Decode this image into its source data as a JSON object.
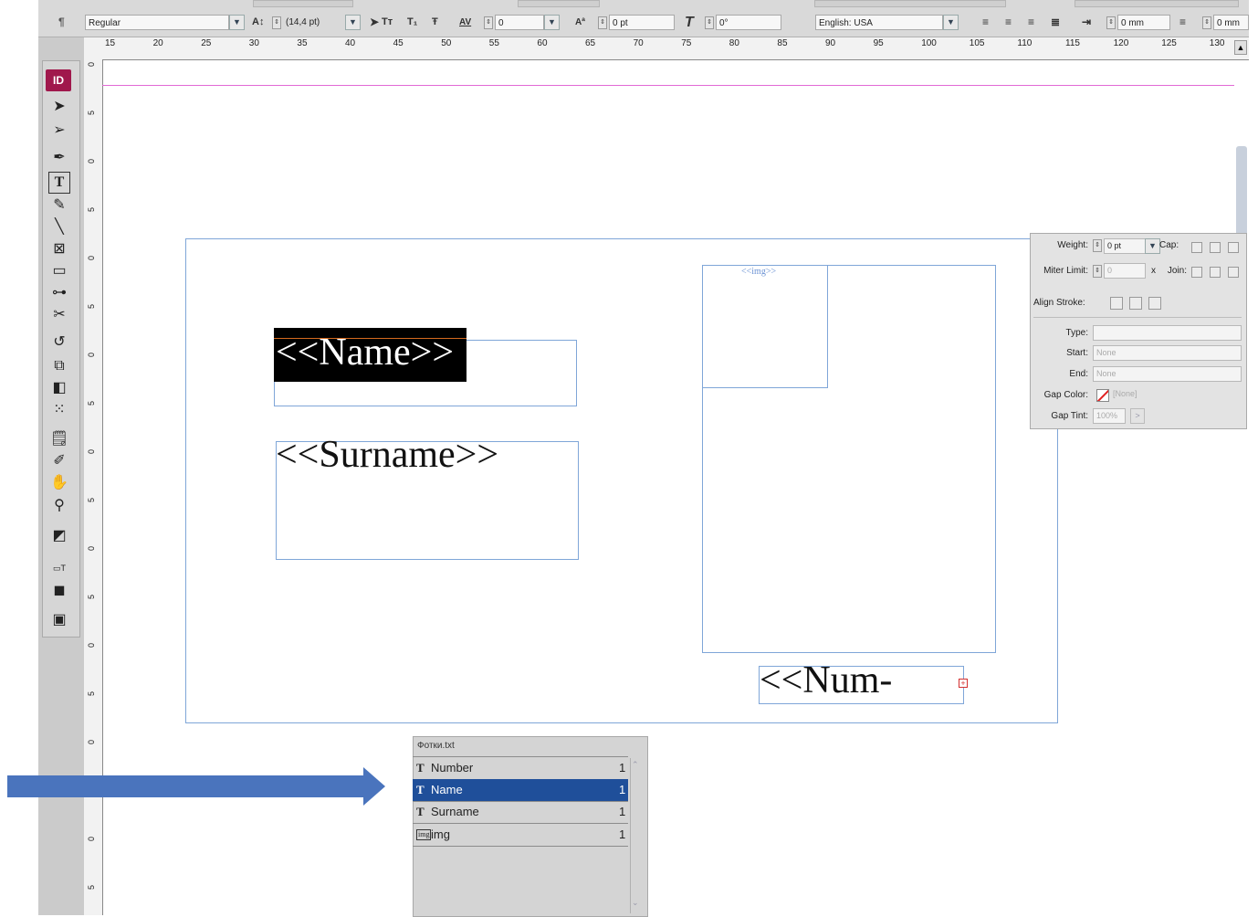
{
  "control_bar": {
    "font_style": "Regular",
    "leading": "(14,4 pt)",
    "tracking": "0",
    "baseline_shift": "0 pt",
    "skew": "0°",
    "language": "English: USA",
    "indent_left": "0 mm",
    "indent_right": "0 mm"
  },
  "ruler": {
    "h_ticks": [
      "15",
      "20",
      "25",
      "30",
      "35",
      "40",
      "45",
      "50",
      "55",
      "60",
      "65",
      "70",
      "75",
      "80",
      "85",
      "90",
      "95",
      "100",
      "105",
      "110",
      "115",
      "120",
      "125",
      "130"
    ],
    "v_ticks": [
      "0",
      "5",
      "0",
      "5",
      "0",
      "5",
      "0",
      "5",
      "0",
      "5",
      "0",
      "5",
      "0",
      "5",
      "0",
      "5",
      "0",
      "5"
    ]
  },
  "tools": {
    "logo": "ID"
  },
  "canvas": {
    "name_field": "<<Name>>",
    "surname_field": "<<Surname>>",
    "img_field": "<<img>>",
    "num_field": "<<Num-"
  },
  "stroke_panel": {
    "weight_label": "Weight:",
    "weight_value": "0 pt",
    "cap_label": "Cap:",
    "miter_label": "Miter Limit:",
    "miter_value": "0",
    "join_label": "Join:",
    "align_label": "Align Stroke:",
    "type_label": "Type:",
    "type_value": "",
    "start_label": "Start:",
    "start_value": "None",
    "end_label": "End:",
    "end_value": "None",
    "gap_color_label": "Gap Color:",
    "gap_color_value": "[None]",
    "gap_tint_label": "Gap Tint:",
    "gap_tint_value": "100%"
  },
  "data_merge": {
    "source": "Фотки.txt",
    "fields": [
      {
        "icon": "T",
        "name": "Number",
        "count": "1",
        "selected": false
      },
      {
        "icon": "T",
        "name": "Name",
        "count": "1",
        "selected": true
      },
      {
        "icon": "T",
        "name": "Surname",
        "count": "1",
        "selected": false
      },
      {
        "icon": "img",
        "name": "img",
        "count": "1",
        "selected": false
      }
    ]
  },
  "colors": {
    "accent": "#1f4f9a",
    "frame": "#7fa6d8",
    "arrow": "#4a74bd",
    "margin_guide": "#e26ad6",
    "logo": "#a0184c"
  }
}
